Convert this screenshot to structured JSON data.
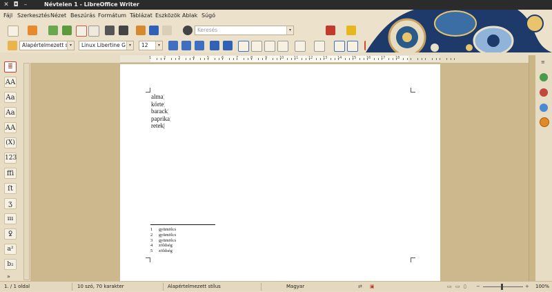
{
  "window": {
    "title": "Névtelen 1 - LibreOffice Writer"
  },
  "menu": [
    "Fájl",
    "Szerkesztés",
    "Nézet",
    "Beszúrás",
    "Formátum",
    "Táblázat",
    "Eszközök",
    "Ablak",
    "Súgó"
  ],
  "toolbar": {
    "search_placeholder": "Keresés",
    "paragraph_style": "Alapértelmezett stí",
    "font_name": "Linux Libertine G",
    "font_size": "12"
  },
  "document": {
    "lines": [
      "alma",
      "körte",
      "barack",
      "paprika",
      "retek"
    ],
    "footnotes": [
      {
        "num": "1",
        "text": "gyümölcs"
      },
      {
        "num": "2",
        "text": "gyümölcs"
      },
      {
        "num": "3",
        "text": "gyümölcs"
      },
      {
        "num": "4",
        "text": "zöldség"
      },
      {
        "num": "5",
        "text": "zöldség"
      }
    ]
  },
  "ruler": {
    "labels": [
      "1",
      "2",
      "3",
      "4",
      "5",
      "6",
      "7",
      "8",
      "9",
      "10",
      "11",
      "12",
      "13",
      "14",
      "15",
      "16",
      "17",
      "18"
    ]
  },
  "left_sidebar": [
    "AA",
    "Aa",
    "Aa",
    "AA",
    "(X)",
    "123",
    "ffi",
    "ſt",
    "ʒ",
    "ııı",
    "ꝿ",
    "a²",
    "b₂"
  ],
  "status": {
    "page": "1. / 1 oldal",
    "words": "10 szó, 70 karakter",
    "style": "Alapértelmezett stílus",
    "language": "Magyar",
    "zoom": "100%"
  },
  "colors": {
    "accent": "#2f62b7",
    "page_bg": "#cdb88e",
    "chrome": "#ece2cb"
  }
}
